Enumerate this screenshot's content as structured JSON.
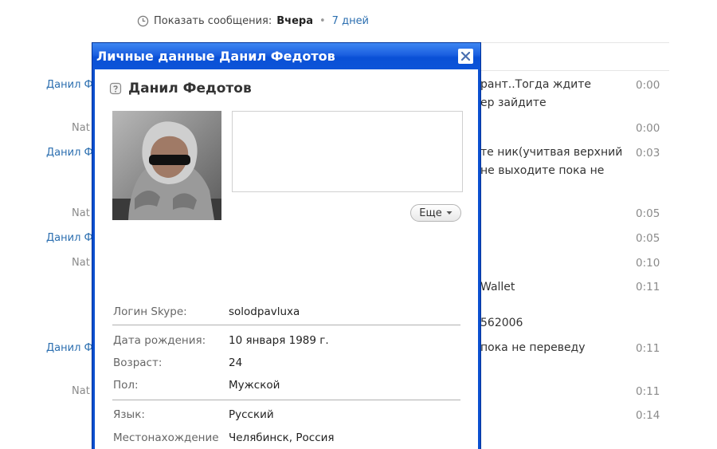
{
  "topbar": {
    "label": "Показать сообщения:",
    "selected": "Вчера",
    "separator": "•",
    "alt_link": "7 дней"
  },
  "chat": {
    "senders": [
      {
        "name": "Данил Ф",
        "color": "blue"
      },
      {
        "name": "Nat",
        "color": "gray"
      },
      {
        "name": "Данил Ф",
        "color": "blue"
      },
      {
        "name": "Nat",
        "color": "gray"
      },
      {
        "name": "Данил Ф",
        "color": "blue"
      },
      {
        "name": "Nat",
        "color": "gray"
      },
      {
        "name": "Данил Ф",
        "color": "blue"
      },
      {
        "name": "Nat",
        "color": "gray"
      }
    ],
    "messages": [
      "рант..Тогда ждите",
      "ер зайдите",
      "те ник(учитвая верхний",
      "не выходите пока не",
      "Wallet",
      "562006",
      "пока не переведу"
    ],
    "times": [
      "0:00",
      "0:00",
      "0:03",
      "0:05",
      "0:05",
      "0:10",
      "0:11",
      "0:11",
      "0:11",
      "0:14"
    ]
  },
  "dialog": {
    "title": "Личные данные Данил Федотов",
    "close_icon": "close-icon",
    "user_name": "Данил Федотов",
    "status_icon": "unknown-status-icon",
    "more_label": "Еще",
    "fields": {
      "skype_login": {
        "label": "Логин Skype:",
        "value": "solodpavluxa"
      },
      "birth_date": {
        "label": "Дата рождения:",
        "value": "10 января 1989 г."
      },
      "age": {
        "label": "Возраст:",
        "value": "24"
      },
      "gender": {
        "label": "Пол:",
        "value": "Мужской"
      },
      "language": {
        "label": "Язык:",
        "value": "Русский"
      },
      "location": {
        "label": "Местонахождение",
        "value": "Челябинск, Россия"
      }
    }
  },
  "colors": {
    "title_bar": "#0a50d6",
    "link_blue": "#2c6fb0",
    "muted_gray": "#8a8a8a"
  }
}
